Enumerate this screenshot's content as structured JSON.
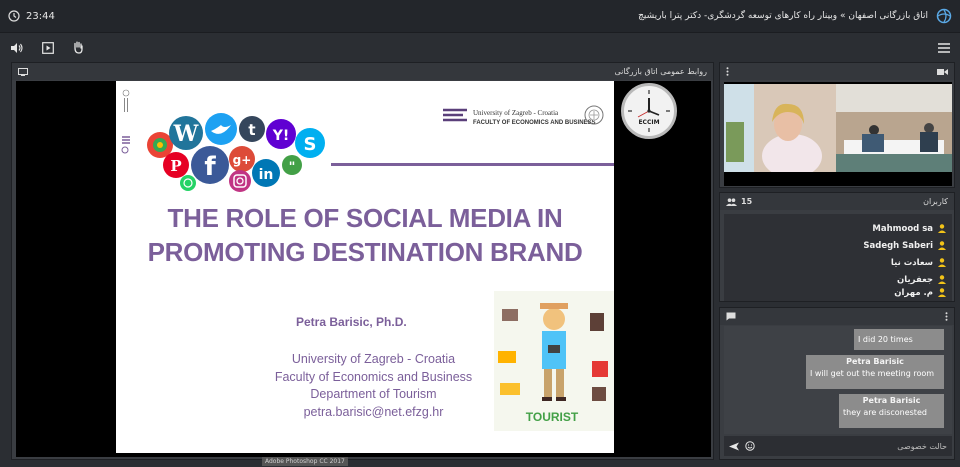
{
  "topbar": {
    "time": "23:44",
    "title": "اتاق بازرگانی اصفهان » وبینار راه کارهای توسعه گردشگری- دکتر پترا باریشیچ"
  },
  "main": {
    "header": "روابط عمومی اتاق بازرگانی"
  },
  "slide": {
    "title_line1": "THE ROLE OF SOCIAL MEDIA IN",
    "title_line2": "PROMOTING DESTINATION BRAND",
    "author": "Petra Barisic, Ph.D.",
    "lines": [
      "University of Zagreb - Croatia",
      "Faculty of Economics and Business",
      "Department of Tourism",
      "petra.barisic@net.efzg.hr"
    ],
    "uni_name": "University of Zagreb - Croatia",
    "faculty_name": "FACULTY OF ECONOMICS AND BUSINESS",
    "clock_label": "ECCIM",
    "tourist_label": "TOURIST"
  },
  "users": {
    "header": "کاربران",
    "count": "15",
    "items": [
      "Mahmood sa",
      "Sadegh Saberi",
      "سعادت نیا",
      "جعفریان",
      "م. مهران"
    ]
  },
  "chat": {
    "messages": [
      {
        "sender": "",
        "text": "I did 20 times"
      },
      {
        "sender": "Petra Barisic",
        "text": "I will get out the meeting room"
      },
      {
        "sender": "Petra Barisic",
        "text": "they are disconested"
      }
    ],
    "footer_label": "حالت خصوصی"
  },
  "watermark": "Adobe Photoshop CC 2017",
  "colors": {
    "slide_purple": "#7b5f9a",
    "user_icon": "#f2c318",
    "chat_bubble": "#8c8c8c"
  }
}
